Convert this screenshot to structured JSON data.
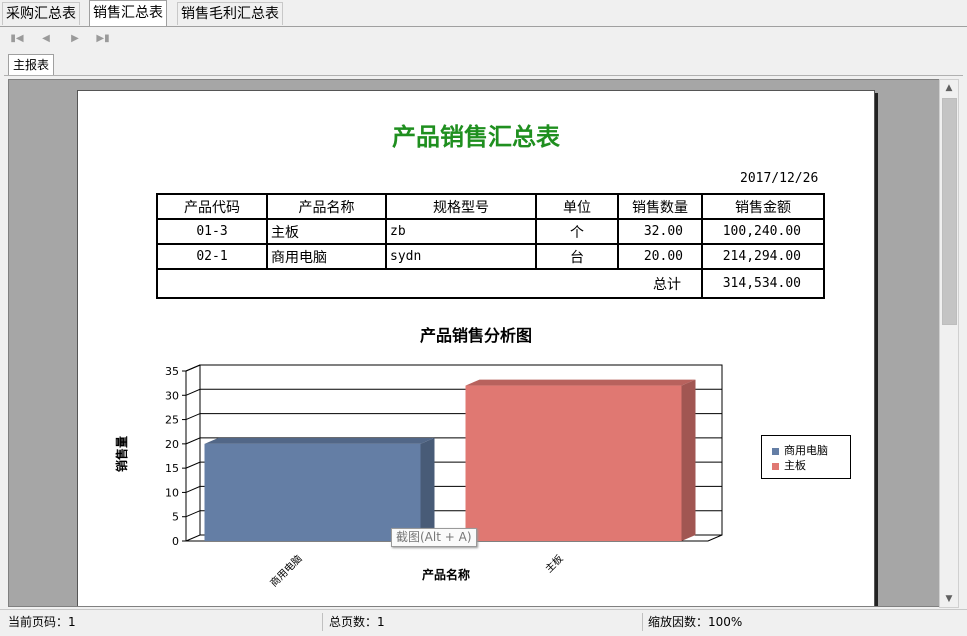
{
  "tabs": [
    "采购汇总表",
    "销售汇总表",
    "销售毛利汇总表"
  ],
  "active_tab": 1,
  "subtabs": [
    "主报表"
  ],
  "report": {
    "title": "产品销售汇总表",
    "date": "2017/12/26",
    "columns": [
      "产品代码",
      "产品名称",
      "规格型号",
      "单位",
      "销售数量",
      "销售金额"
    ],
    "rows": [
      [
        "01-3",
        "主板",
        "zb",
        "个",
        "32.00",
        "100,240.00"
      ],
      [
        "02-1",
        "商用电脑",
        "sydn",
        "台",
        "20.00",
        "214,294.00"
      ]
    ],
    "total_label": "总计",
    "total_value": "314,534.00"
  },
  "chart_data": {
    "type": "bar",
    "title": "产品销售分析图",
    "xlabel": "产品名称",
    "ylabel": "销售量",
    "categories": [
      "商用电脑",
      "主板"
    ],
    "values": [
      20,
      32
    ],
    "ylim": [
      0,
      35
    ],
    "yticks": [
      0,
      5,
      10,
      15,
      20,
      25,
      30,
      35
    ],
    "grid": true,
    "legend": "right",
    "colors": [
      "#647ea5",
      "#e07872"
    ]
  },
  "tooltip": "截图(Alt + A)",
  "status": {
    "current_page": "当前页码：1",
    "total_pages": "总页数：1",
    "zoom": "缩放因数：100%"
  }
}
